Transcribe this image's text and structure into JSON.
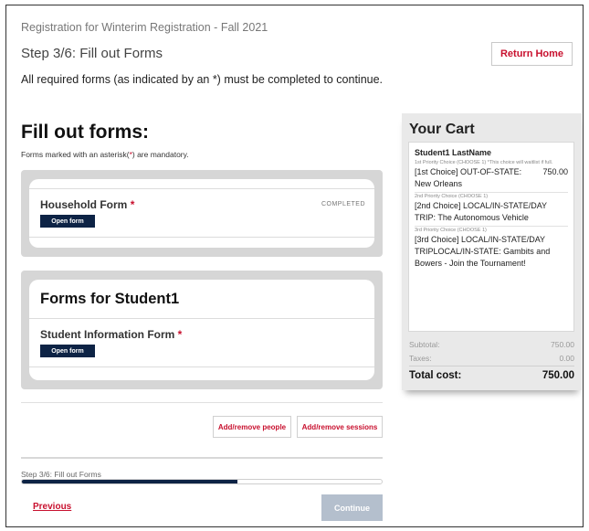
{
  "header": {
    "registration_title": "Registration for Winterim Registration - Fall 2021",
    "step_title": "Step 3/6: Fill out Forms",
    "required_note": "All required forms (as indicated by an *) must be completed to continue.",
    "return_home_label": "Return Home"
  },
  "forms": {
    "heading": "Fill out forms:",
    "asterisk_note_prefix": "Forms marked with an asterisk(",
    "asterisk_symbol": "*",
    "asterisk_note_suffix": ") are mandatory.",
    "household": {
      "title": "Household Form",
      "required_mark": "*",
      "open_label": "Open form",
      "status": "COMPLETED"
    },
    "student_group": {
      "heading": "Forms for Student1",
      "form_title": "Student Information Form",
      "required_mark": "*",
      "open_label": "Open form"
    }
  },
  "actions": {
    "add_remove_people": "Add/remove people",
    "add_remove_sessions": "Add/remove sessions"
  },
  "progress": {
    "label": "Step 3/6: Fill out Forms",
    "fraction": 0.6
  },
  "nav": {
    "previous_label": "Previous",
    "continue_label": "Continue"
  },
  "cart": {
    "title": "Your Cart",
    "student_name": "Student1 LastName",
    "choices": [
      {
        "priority_note": "1st Priority Choice (CHOOSE 1) *This choice will waitlist if full.",
        "label": "[1st Choice] OUT-OF-STATE: New Orleans",
        "price": "750.00"
      },
      {
        "priority_note": "2nd Priority Choice (CHOOSE 1)",
        "label": "[2nd Choice] LOCAL/IN-STATE/DAY TRIP: The Autonomous Vehicle",
        "price": ""
      },
      {
        "priority_note": "3rd Priority Choice (CHOOSE 1)",
        "label": "[3rd Choice] LOCAL/IN-STATE/DAY TRIPLOCAL/IN-STATE: Gambits and Bowers - Join the Tournament!",
        "price": ""
      }
    ],
    "subtotal_label": "Subtotal:",
    "subtotal_value": "750.00",
    "taxes_label": "Taxes:",
    "taxes_value": "0.00",
    "total_label": "Total cost:",
    "total_value": "750.00"
  },
  "colors": {
    "accent_red": "#c8102e",
    "navy": "#0d2345",
    "disabled_button": "#b4bfcd"
  }
}
